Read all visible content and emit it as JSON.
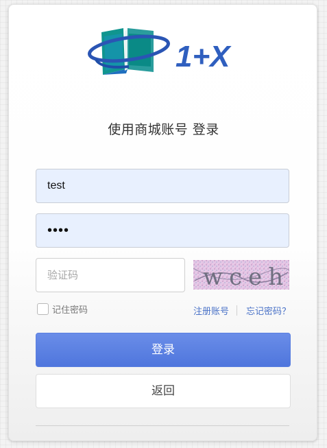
{
  "logo": {
    "text": "1+X",
    "brand_color": "#2f5fbf",
    "accent_color": "#14a39b"
  },
  "title": "使用商城账号 登录",
  "form": {
    "username_value": "test",
    "password_value": "••••",
    "captcha_placeholder": "验证码",
    "captcha_text": "wceh",
    "remember_label": "记住密码",
    "register_link": "注册账号",
    "forgot_link": "忘记密码？"
  },
  "buttons": {
    "login_label": "登录",
    "back_label": "返回"
  },
  "colors": {
    "primary": "#5b80e0",
    "link": "#4a72c7",
    "input_autofill_bg": "#e8f0fe"
  }
}
